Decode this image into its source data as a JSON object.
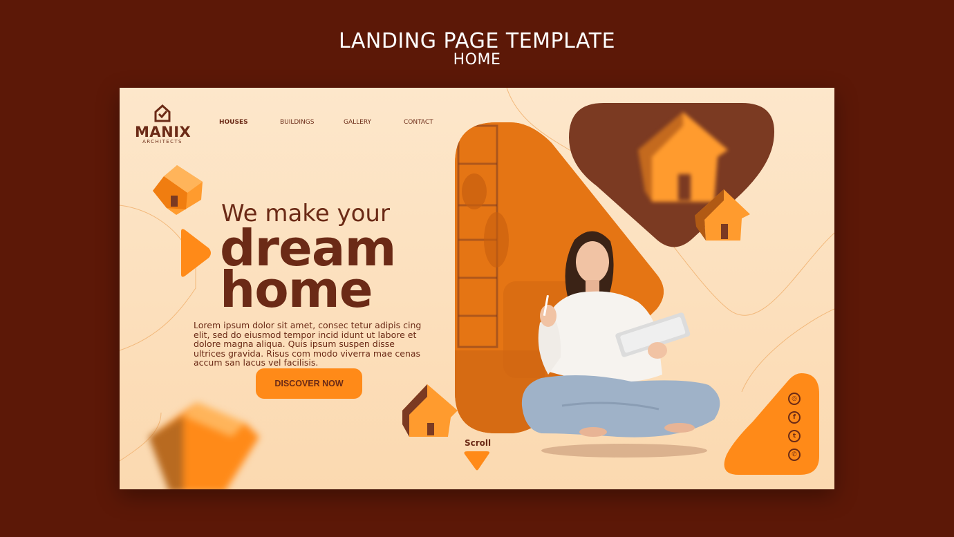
{
  "page": {
    "title": "LANDING PAGE TEMPLATE",
    "subtitle": "HOME"
  },
  "brand": {
    "name": "MANIX",
    "tagline": "ARCHITECTS",
    "icon": "house-check-icon"
  },
  "nav": {
    "items": [
      {
        "label": "HOUSES",
        "active": true
      },
      {
        "label": "BUILDINGS",
        "active": false
      },
      {
        "label": "GALLERY",
        "active": false
      },
      {
        "label": "CONTACT",
        "active": false
      }
    ]
  },
  "hero": {
    "line1": "We make your",
    "line2": "dream",
    "line3": "home",
    "body": "Lorem ipsum dolor sit amet, consec tetur adipis cing elit, sed do eiusmod tempor incid idunt ut labore et dolore magna aliqua. Quis ipsum suspen disse ultrices gravida. Risus com modo viverra mae cenas accum san lacus vel facilisis.",
    "cta_label": "DISCOVER NOW"
  },
  "scroll": {
    "label": "Scroll",
    "icon": "down-triangle-icon"
  },
  "social": [
    {
      "icon": "instagram-icon",
      "glyph": "◎"
    },
    {
      "icon": "facebook-icon",
      "glyph": "f"
    },
    {
      "icon": "twitter-icon",
      "glyph": "t"
    },
    {
      "icon": "whatsapp-icon",
      "glyph": "✆"
    }
  ],
  "colors": {
    "outer_background": "#5c1807",
    "card_background": "#fde7cb",
    "accent_orange": "#ff8a18",
    "text_brown": "#6b2a16",
    "dark_brown_shape": "#7b3a22"
  }
}
